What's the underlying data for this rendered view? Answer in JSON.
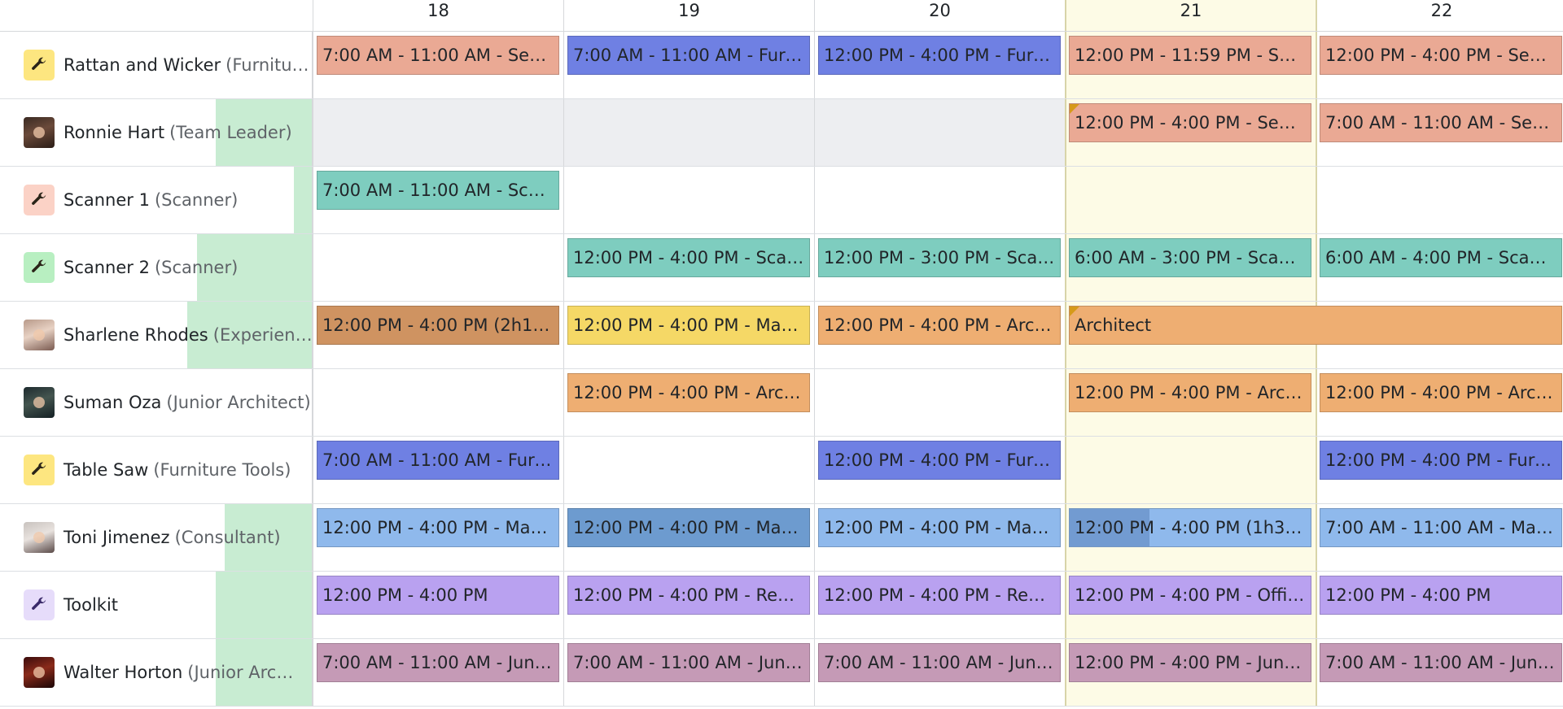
{
  "days": [
    {
      "label": "18",
      "today": false
    },
    {
      "label": "19",
      "today": false
    },
    {
      "label": "20",
      "today": false
    },
    {
      "label": "21",
      "today": true
    },
    {
      "label": "22",
      "today": false
    }
  ],
  "rows": [
    {
      "name": "Rattan and Wicker",
      "role": "(Furnitu…",
      "icon": "wrench-icon",
      "avatar_color": "#fde680",
      "progress": 0,
      "shifts": [
        {
          "text": "7:00 AM - 11:00 AM - Seni…",
          "color": "salmon"
        },
        {
          "text": "7:00 AM - 11:00 AM - Furn…",
          "color": "blue"
        },
        {
          "text": "12:00 PM - 4:00 PM - Furni…",
          "color": "blue"
        },
        {
          "text": "12:00 PM - 11:59 PM - Sen…",
          "color": "salmon"
        },
        {
          "text": "12:00 PM - 4:00 PM - Seni…",
          "color": "salmon"
        }
      ]
    },
    {
      "name": "Ronnie Hart",
      "role": "(Team Leader)",
      "icon": "person-avatar",
      "progress": 0.31,
      "shifts": [
        null,
        null,
        null,
        {
          "text": "12:00 PM - 4:00 PM - Seni…",
          "color": "salmon",
          "flag": true
        },
        {
          "text": "7:00 AM - 11:00 AM - Seni…",
          "color": "salmon"
        }
      ]
    },
    {
      "name": "Scanner 1",
      "role": "(Scanner)",
      "icon": "wrench-icon",
      "avatar_color": "#fbd2c6",
      "progress": 0.06,
      "shifts": [
        {
          "text": "7:00 AM - 11:00 AM - Scan…",
          "color": "teal"
        },
        null,
        null,
        null,
        null
      ]
    },
    {
      "name": "Scanner 2",
      "role": "(Scanner)",
      "icon": "wrench-icon",
      "avatar_color": "#b8efc1",
      "progress": 0.37,
      "shifts": [
        null,
        {
          "text": "12:00 PM - 4:00 PM - Scan…",
          "color": "teal"
        },
        {
          "text": "12:00 PM - 3:00 PM - Scan…",
          "color": "teal"
        },
        {
          "text": "6:00 AM - 3:00 PM - Scanner",
          "color": "teal"
        },
        {
          "text": "6:00 AM - 4:00 PM - Scanner",
          "color": "teal"
        }
      ]
    },
    {
      "name": "Sharlene Rhodes",
      "role": "(Experien…",
      "icon": "person-avatar",
      "progress": 0.4,
      "shifts": [
        {
          "text": "12:00 PM - 4:00 PM (2h15)…",
          "color": "brown"
        },
        {
          "text": "12:00 PM - 4:00 PM - Man…",
          "color": "yellow"
        },
        {
          "text": "12:00 PM - 4:00 PM - Archi…",
          "color": "orange"
        },
        {
          "text": "Architect",
          "color": "orange",
          "flag": true,
          "span": 2
        },
        null
      ]
    },
    {
      "name": "Suman Oza",
      "role": "(Junior Architect)",
      "icon": "person-avatar",
      "progress": 0,
      "shifts": [
        null,
        {
          "text": "12:00 PM - 4:00 PM - Archi…",
          "color": "orange"
        },
        null,
        {
          "text": "12:00 PM - 4:00 PM - Archi…",
          "color": "orange"
        },
        {
          "text": "12:00 PM - 4:00 PM - Archi…",
          "color": "orange"
        }
      ]
    },
    {
      "name": "Table Saw",
      "role": "(Furniture Tools)",
      "icon": "wrench-icon",
      "avatar_color": "#fde680",
      "progress": 0,
      "shifts": [
        {
          "text": "7:00 AM - 11:00 AM - Furn…",
          "color": "blue"
        },
        null,
        {
          "text": "12:00 PM - 4:00 PM - Furni…",
          "color": "blue"
        },
        null,
        {
          "text": "12:00 PM - 4:00 PM - Furni…",
          "color": "blue"
        }
      ]
    },
    {
      "name": "Toni Jimenez",
      "role": "(Consultant)",
      "icon": "person-avatar",
      "progress": 0.28,
      "shifts": [
        {
          "text": "12:00 PM - 4:00 PM - Man…",
          "color": "sky"
        },
        {
          "text": "12:00 PM - 4:00 PM - Man…",
          "color": "sky-dark"
        },
        {
          "text": "12:00 PM - 4:00 PM - Man…",
          "color": "sky"
        },
        {
          "text": "12:00 PM - 4:00 PM (1h30)…",
          "color": "sky",
          "split": true
        },
        {
          "text": "7:00 AM - 11:00 AM - Man…",
          "color": "sky"
        }
      ]
    },
    {
      "name": "Toolkit",
      "role": "",
      "icon": "wrench-icon",
      "avatar_color": "#e6dcfa",
      "progress": 0.31,
      "shifts": [
        {
          "text": "12:00 PM - 4:00 PM",
          "color": "purple"
        },
        {
          "text": "12:00 PM - 4:00 PM - Reno…",
          "color": "purple"
        },
        {
          "text": "12:00 PM - 4:00 PM - Reno…",
          "color": "purple"
        },
        {
          "text": "12:00 PM - 4:00 PM - Offic…",
          "color": "purple"
        },
        {
          "text": "12:00 PM - 4:00 PM",
          "color": "purple"
        }
      ]
    },
    {
      "name": "Walter Horton",
      "role": "(Junior Arc…",
      "icon": "person-avatar",
      "progress": 0.31,
      "shifts": [
        {
          "text": "7:00 AM - 11:00 AM - Juni…",
          "color": "mauve"
        },
        {
          "text": "7:00 AM - 11:00 AM - Juni…",
          "color": "mauve"
        },
        {
          "text": "7:00 AM - 11:00 AM - Juni…",
          "color": "mauve"
        },
        {
          "text": "12:00 PM - 4:00 PM - Juni…",
          "color": "mauve"
        },
        {
          "text": "7:00 AM - 11:00 AM - Juni…",
          "color": "mauve"
        }
      ]
    }
  ]
}
